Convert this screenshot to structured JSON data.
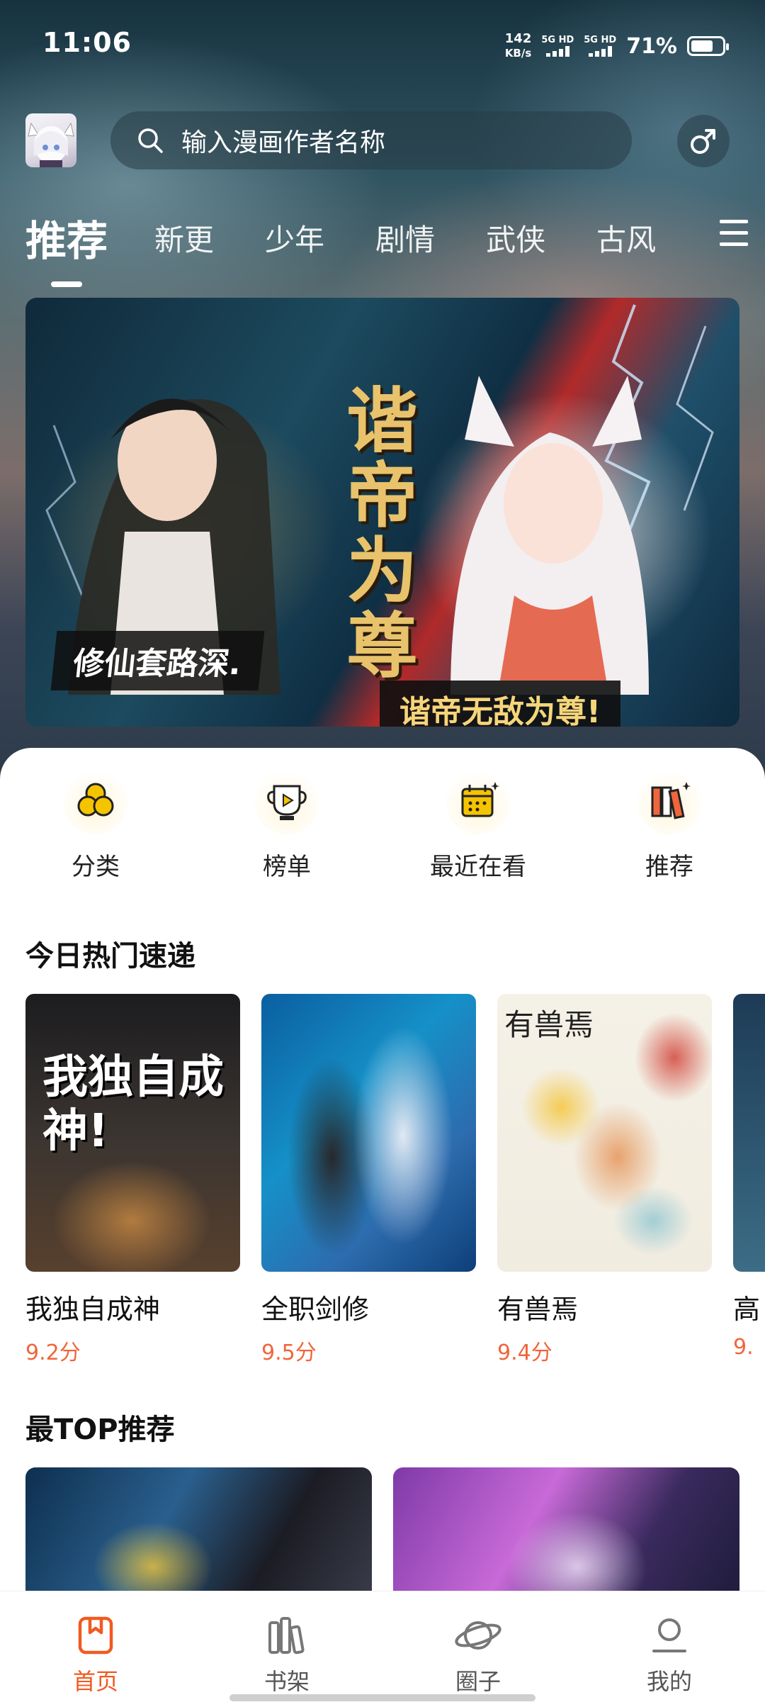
{
  "status_bar": {
    "time": "11:06",
    "net_speed_value": "142",
    "net_speed_unit": "KB/s",
    "sim1": "5G HD",
    "sim2": "5G HD",
    "battery": "71%",
    "battery_level": 0.71
  },
  "search": {
    "placeholder": "输入漫画作者名称"
  },
  "tabs": [
    "推荐",
    "新更",
    "少年",
    "剧情",
    "武侠",
    "古风"
  ],
  "active_tab": "推荐",
  "banner": {
    "title": "谐帝为尊",
    "tagline_left": "修仙套路深.",
    "tagline_right": "谐帝无敌为尊!"
  },
  "quick_entries": [
    {
      "label": "分类",
      "icon": "category-icon"
    },
    {
      "label": "榜单",
      "icon": "ranking-icon"
    },
    {
      "label": "最近在看",
      "icon": "calendar-icon"
    },
    {
      "label": "推荐",
      "icon": "books-icon"
    }
  ],
  "hot_section": {
    "title": "今日热门速递",
    "items": [
      {
        "name": "我独自成神",
        "score": "9.2分",
        "cover_title": "我独自成神!"
      },
      {
        "name": "全职剑修",
        "score": "9.5分"
      },
      {
        "name": "有兽焉",
        "score": "9.4分",
        "cover_title": "有兽焉"
      },
      {
        "name": "高",
        "score": "9."
      }
    ]
  },
  "top_section": {
    "title": "最TOP推荐"
  },
  "bottom_nav": [
    {
      "label": "首页",
      "icon": "home-icon",
      "active": true
    },
    {
      "label": "书架",
      "icon": "bookshelf-icon",
      "active": false
    },
    {
      "label": "圈子",
      "icon": "planet-icon",
      "active": false
    },
    {
      "label": "我的",
      "icon": "profile-icon",
      "active": false
    }
  ],
  "colors": {
    "accent": "#f15a22",
    "score": "#f0663b",
    "icon_yellow": "#f5b800"
  }
}
